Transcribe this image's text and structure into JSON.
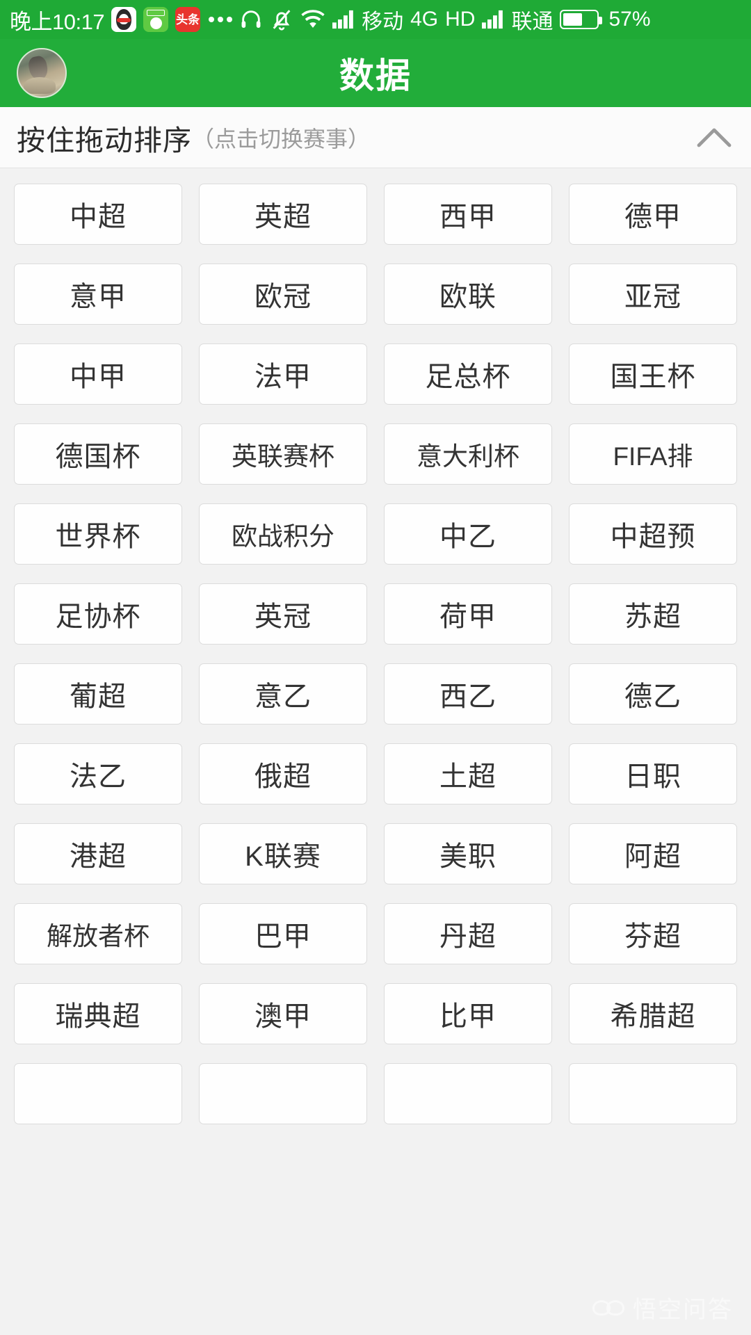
{
  "statusbar": {
    "time": "晚上10:17",
    "app_icons": [
      {
        "name": "qq-app-icon",
        "label": "QQ"
      },
      {
        "name": "soccer-app-icon",
        "label": "球"
      },
      {
        "name": "toutiao-app-icon",
        "label": "头条"
      }
    ],
    "more_icon": "more-dots-icon",
    "headset_icon": "headset-icon",
    "mute_icon": "bell-muted-icon",
    "wifi_icon": "wifi-icon",
    "signal1_icon": "signal-bars-icon",
    "carrier1": "移动",
    "network": "4G",
    "hd": "HD",
    "signal2_icon": "signal-bars-icon",
    "carrier2": "联通",
    "battery_icon": "battery-icon",
    "battery_percent": "57%",
    "battery_level": 57
  },
  "appbar": {
    "title": "数据",
    "avatar": "user-avatar"
  },
  "sortbar": {
    "main_text": "按住拖动排序",
    "sub_text": "（点击切换赛事）",
    "collapse_icon": "chevron-up-icon"
  },
  "watermark": {
    "text": "悟空问答",
    "mark": "wukong-logo-icon"
  },
  "colors": {
    "status_green": "#1faa36",
    "header_green": "#22ad3a",
    "page_bg": "#f2f2f2",
    "cell_bg": "#fefefe",
    "cell_border": "#dcdcdc",
    "text_primary": "#333333",
    "text_muted": "#9b9b9b"
  },
  "grid": {
    "columns": 4,
    "leagues": [
      "中超",
      "英超",
      "西甲",
      "德甲",
      "意甲",
      "欧冠",
      "欧联",
      "亚冠",
      "中甲",
      "法甲",
      "足总杯",
      "国王杯",
      "德国杯",
      "英联赛杯",
      "意大利杯",
      "FIFA排",
      "世界杯",
      "欧战积分",
      "中乙",
      "中超预",
      "足协杯",
      "英冠",
      "荷甲",
      "苏超",
      "葡超",
      "意乙",
      "西乙",
      "德乙",
      "法乙",
      "俄超",
      "土超",
      "日职",
      "港超",
      "K联赛",
      "美职",
      "阿超",
      "解放者杯",
      "巴甲",
      "丹超",
      "芬超",
      "瑞典超",
      "澳甲",
      "比甲",
      "希腊超",
      "",
      "",
      "",
      ""
    ]
  }
}
